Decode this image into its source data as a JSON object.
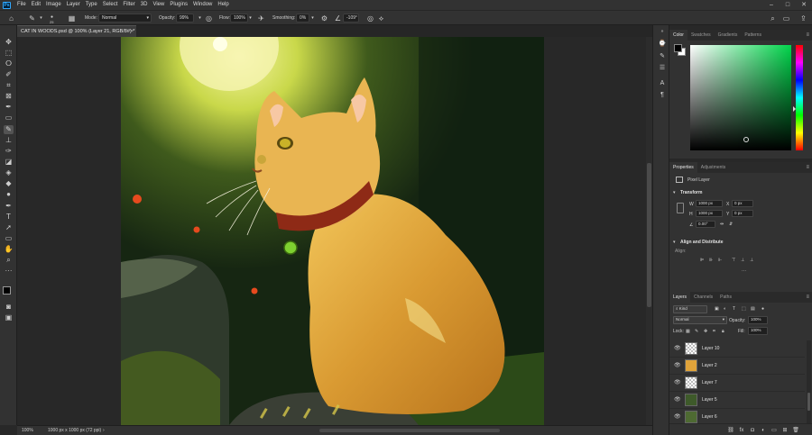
{
  "menubar": {
    "items": [
      "File",
      "Edit",
      "Image",
      "Layer",
      "Type",
      "Select",
      "Filter",
      "3D",
      "View",
      "Plugins",
      "Window",
      "Help"
    ],
    "logo": "Ps"
  },
  "options": {
    "brush_size": "25",
    "mode_label": "Mode:",
    "mode_value": "Normal",
    "opacity_label": "Opacity:",
    "opacity_value": "99%",
    "flow_label": "Flow:",
    "flow_value": "100%",
    "smoothing_label": "Smoothing:",
    "smoothing_value": "0%",
    "angle_value": "-109°"
  },
  "document": {
    "tab_title": "CAT IN WOODS.psd @ 100% (Layer 21, RGB/8#) *",
    "zoom": "100%",
    "dimensions": "1000 px x 1000 px (72 ppi)"
  },
  "color_panel": {
    "tabs": [
      "Color",
      "Swatches",
      "Gradients",
      "Patterns"
    ],
    "accent": "#00d44a"
  },
  "properties_panel": {
    "tabs": [
      "Properties",
      "Adjustments"
    ],
    "layer_type": "Pixel Layer",
    "transform_label": "Transform",
    "w_label": "W",
    "w_value": "1000 px",
    "h_label": "H",
    "h_value": "1000 px",
    "x_label": "X",
    "x_value": "0 px",
    "y_label": "Y",
    "y_value": "0 px",
    "angle_value": "0.00°",
    "align_label": "Align and Distribute",
    "align_sub": "Align:"
  },
  "layers_panel": {
    "tabs": [
      "Layers",
      "Channels",
      "Paths"
    ],
    "filter_kind": "Kind",
    "blend_mode": "Normal",
    "opacity_label": "Opacity:",
    "opacity_value": "100%",
    "lock_label": "Lock:",
    "fill_label": "Fill:",
    "fill_value": "100%",
    "layers": [
      "Layer 10",
      "Layer 2",
      "Layer 7",
      "Layer 5",
      "Layer 6"
    ]
  }
}
